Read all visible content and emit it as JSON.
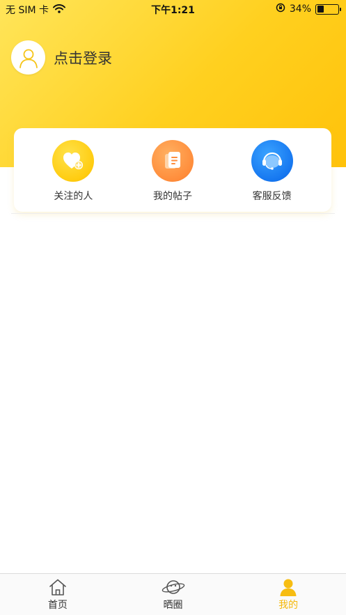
{
  "status_bar": {
    "carrier": "无 SIM 卡",
    "time": "下午1:21",
    "battery_percent": "34%",
    "battery_level": 0.34
  },
  "profile": {
    "login_label": "点击登录"
  },
  "quick_actions": [
    {
      "label": "关注的人",
      "icon": "heart-plus-icon"
    },
    {
      "label": "我的帖子",
      "icon": "document-icon"
    },
    {
      "label": "客服反馈",
      "icon": "headset-icon"
    }
  ],
  "tab_bar": {
    "active": "mine",
    "tabs": [
      {
        "key": "home",
        "label": "首页",
        "icon": "home-icon"
      },
      {
        "key": "circle",
        "label": "晒圈",
        "icon": "planet-icon"
      },
      {
        "key": "mine",
        "label": "我的",
        "icon": "person-icon"
      }
    ]
  },
  "colors": {
    "brand_yellow": "#FFCC10",
    "active_tab": "#F5B80A",
    "posts_orange": "#FF8D3B",
    "service_blue": "#1677F0"
  }
}
